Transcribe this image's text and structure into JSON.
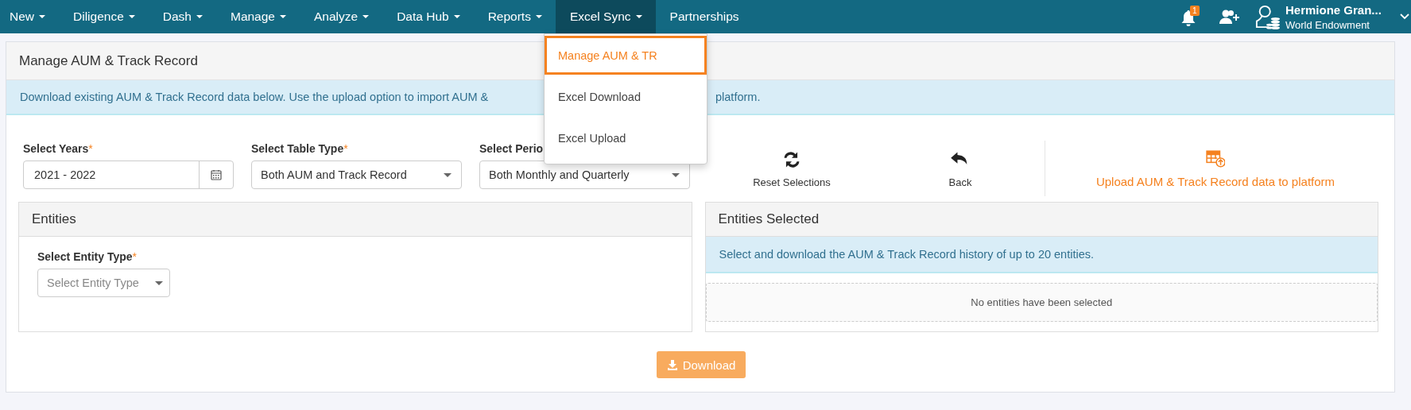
{
  "nav": {
    "items": [
      {
        "label": "New",
        "caret": true,
        "selected": false
      },
      {
        "label": "Diligence",
        "caret": true,
        "selected": false
      },
      {
        "label": "Dash",
        "caret": true,
        "selected": false
      },
      {
        "label": "Manage",
        "caret": true,
        "selected": false
      },
      {
        "label": "Analyze",
        "caret": true,
        "selected": false
      },
      {
        "label": "Data Hub",
        "caret": true,
        "selected": false
      },
      {
        "label": "Reports",
        "caret": true,
        "selected": false
      },
      {
        "label": "Excel Sync",
        "caret": true,
        "selected": true
      },
      {
        "label": "Partnerships",
        "caret": false,
        "selected": false
      }
    ],
    "notifications": "1",
    "user": {
      "name": "Hermione Gran...",
      "org": "World Endowment"
    }
  },
  "dropdown": {
    "items": [
      {
        "label": "Manage AUM & TR",
        "selected": true
      },
      {
        "label": "Excel Download",
        "selected": false
      },
      {
        "label": "Excel Upload",
        "selected": false
      }
    ]
  },
  "page": {
    "title": "Manage AUM & Track Record",
    "alert": [
      "Download existing AUM & Track Record data below. Use the upload option to import AUM &",
      "platform."
    ],
    "fields": [
      {
        "label": "Select Years",
        "asterisk": "*",
        "kind": "date",
        "value": "2021 - 2022"
      },
      {
        "label": "Select Table Type",
        "asterisk": "*",
        "kind": "select",
        "value": "Both AUM and Track Record"
      },
      {
        "label": "Select Perio",
        "kind": "select",
        "value": "Both Monthly and Quarterly"
      }
    ],
    "actions": [
      {
        "label": "Reset Selections",
        "kind": "reset"
      },
      {
        "label": "Back",
        "kind": "back"
      },
      {
        "label": "Upload AUM & Track Record data to platform",
        "kind": "upload"
      }
    ],
    "entities": {
      "title": "Entities",
      "field": {
        "label": "Select Entity Type",
        "asterisk": "*",
        "placeholder": "Select Entity Type"
      }
    },
    "selected": {
      "title": "Entities Selected",
      "info": "Select and download the AUM & Track Record history of up to 20 entities.",
      "empty": "No entities have been selected"
    },
    "download": "Download"
  }
}
